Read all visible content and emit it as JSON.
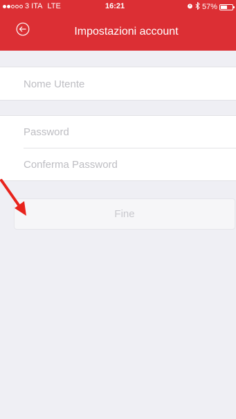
{
  "status_bar": {
    "carrier": "3 ITA",
    "network": "LTE",
    "time": "16:21",
    "battery_percent": "57%",
    "battery_level": 0.57
  },
  "header": {
    "title": "Impostazioni account"
  },
  "form": {
    "username_placeholder": "Nome Utente",
    "username_value": "",
    "password_placeholder": "Password",
    "password_value": "",
    "confirm_placeholder": "Conferma Password",
    "confirm_value": ""
  },
  "actions": {
    "done_label": "Fine"
  },
  "colors": {
    "brand_red": "#dc2f34",
    "background": "#efeff4",
    "annotation_arrow": "#e8231c"
  },
  "icons": {
    "back": "back-arrow-circle-icon",
    "alarm": "alarm-icon",
    "bluetooth": "bluetooth-icon",
    "battery": "battery-icon"
  }
}
